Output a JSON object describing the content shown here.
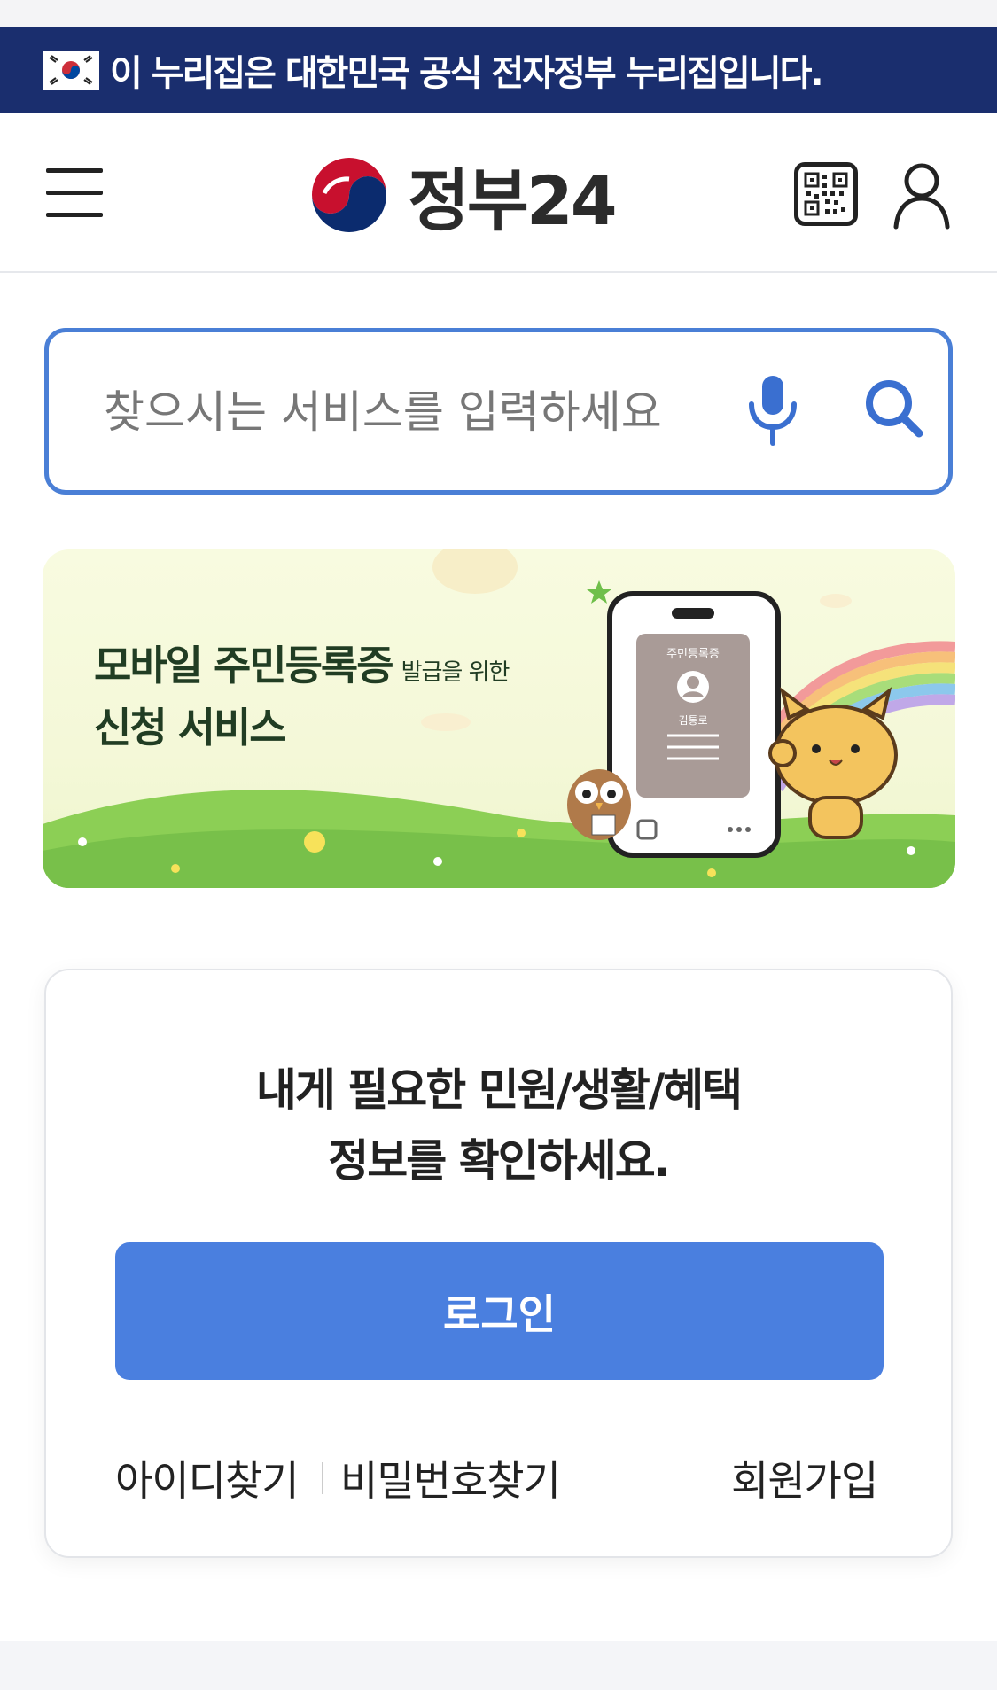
{
  "gov_banner": {
    "text": "이 누리집은 대한민국 공식 전자정부 누리집입니다."
  },
  "header": {
    "logo_text": "정부24"
  },
  "search": {
    "placeholder": "찾으시는 서비스를 입력하세요"
  },
  "promo": {
    "title_main": "모바일 주민등록증",
    "title_small": "발급을 위한",
    "title_line2": "신청 서비스",
    "card_label": "주민등록증",
    "card_name": "김통로"
  },
  "login_card": {
    "message_line1": "내게 필요한 민원/생활/혜택",
    "message_line2": "정보를 확인하세요.",
    "login_button": "로그인",
    "find_id": "아이디찾기",
    "find_password": "비밀번호찾기",
    "sign_up": "회원가입"
  },
  "colors": {
    "banner": "#1a2e6e",
    "accent": "#4a7fdf",
    "search_border": "#4a7fd6"
  },
  "icons": [
    "korea-flag-icon",
    "hamburger-menu-icon",
    "gov-logo-icon",
    "qr-code-icon",
    "user-icon",
    "microphone-icon",
    "search-icon"
  ]
}
